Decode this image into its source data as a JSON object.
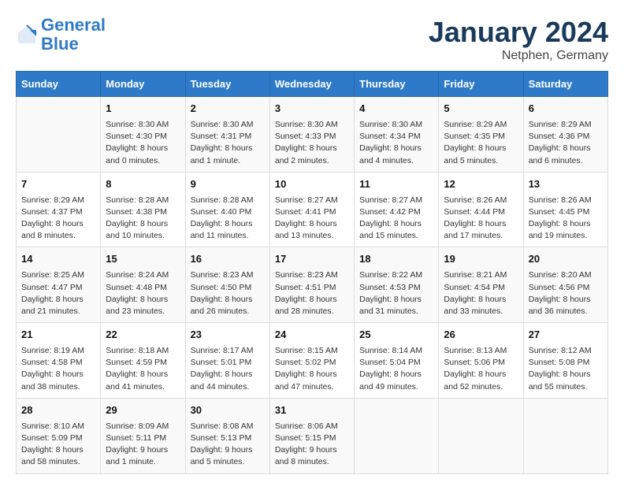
{
  "header": {
    "logo_line1": "General",
    "logo_line2": "Blue",
    "month": "January 2024",
    "location": "Netphen, Germany"
  },
  "days_of_week": [
    "Sunday",
    "Monday",
    "Tuesday",
    "Wednesday",
    "Thursday",
    "Friday",
    "Saturday"
  ],
  "weeks": [
    [
      {
        "num": "",
        "sunrise": "",
        "sunset": "",
        "daylight": ""
      },
      {
        "num": "1",
        "sunrise": "Sunrise: 8:30 AM",
        "sunset": "Sunset: 4:30 PM",
        "daylight": "Daylight: 8 hours and 0 minutes."
      },
      {
        "num": "2",
        "sunrise": "Sunrise: 8:30 AM",
        "sunset": "Sunset: 4:31 PM",
        "daylight": "Daylight: 8 hours and 1 minute."
      },
      {
        "num": "3",
        "sunrise": "Sunrise: 8:30 AM",
        "sunset": "Sunset: 4:33 PM",
        "daylight": "Daylight: 8 hours and 2 minutes."
      },
      {
        "num": "4",
        "sunrise": "Sunrise: 8:30 AM",
        "sunset": "Sunset: 4:34 PM",
        "daylight": "Daylight: 8 hours and 4 minutes."
      },
      {
        "num": "5",
        "sunrise": "Sunrise: 8:29 AM",
        "sunset": "Sunset: 4:35 PM",
        "daylight": "Daylight: 8 hours and 5 minutes."
      },
      {
        "num": "6",
        "sunrise": "Sunrise: 8:29 AM",
        "sunset": "Sunset: 4:36 PM",
        "daylight": "Daylight: 8 hours and 6 minutes."
      }
    ],
    [
      {
        "num": "7",
        "sunrise": "Sunrise: 8:29 AM",
        "sunset": "Sunset: 4:37 PM",
        "daylight": "Daylight: 8 hours and 8 minutes."
      },
      {
        "num": "8",
        "sunrise": "Sunrise: 8:28 AM",
        "sunset": "Sunset: 4:38 PM",
        "daylight": "Daylight: 8 hours and 10 minutes."
      },
      {
        "num": "9",
        "sunrise": "Sunrise: 8:28 AM",
        "sunset": "Sunset: 4:40 PM",
        "daylight": "Daylight: 8 hours and 11 minutes."
      },
      {
        "num": "10",
        "sunrise": "Sunrise: 8:27 AM",
        "sunset": "Sunset: 4:41 PM",
        "daylight": "Daylight: 8 hours and 13 minutes."
      },
      {
        "num": "11",
        "sunrise": "Sunrise: 8:27 AM",
        "sunset": "Sunset: 4:42 PM",
        "daylight": "Daylight: 8 hours and 15 minutes."
      },
      {
        "num": "12",
        "sunrise": "Sunrise: 8:26 AM",
        "sunset": "Sunset: 4:44 PM",
        "daylight": "Daylight: 8 hours and 17 minutes."
      },
      {
        "num": "13",
        "sunrise": "Sunrise: 8:26 AM",
        "sunset": "Sunset: 4:45 PM",
        "daylight": "Daylight: 8 hours and 19 minutes."
      }
    ],
    [
      {
        "num": "14",
        "sunrise": "Sunrise: 8:25 AM",
        "sunset": "Sunset: 4:47 PM",
        "daylight": "Daylight: 8 hours and 21 minutes."
      },
      {
        "num": "15",
        "sunrise": "Sunrise: 8:24 AM",
        "sunset": "Sunset: 4:48 PM",
        "daylight": "Daylight: 8 hours and 23 minutes."
      },
      {
        "num": "16",
        "sunrise": "Sunrise: 8:23 AM",
        "sunset": "Sunset: 4:50 PM",
        "daylight": "Daylight: 8 hours and 26 minutes."
      },
      {
        "num": "17",
        "sunrise": "Sunrise: 8:23 AM",
        "sunset": "Sunset: 4:51 PM",
        "daylight": "Daylight: 8 hours and 28 minutes."
      },
      {
        "num": "18",
        "sunrise": "Sunrise: 8:22 AM",
        "sunset": "Sunset: 4:53 PM",
        "daylight": "Daylight: 8 hours and 31 minutes."
      },
      {
        "num": "19",
        "sunrise": "Sunrise: 8:21 AM",
        "sunset": "Sunset: 4:54 PM",
        "daylight": "Daylight: 8 hours and 33 minutes."
      },
      {
        "num": "20",
        "sunrise": "Sunrise: 8:20 AM",
        "sunset": "Sunset: 4:56 PM",
        "daylight": "Daylight: 8 hours and 36 minutes."
      }
    ],
    [
      {
        "num": "21",
        "sunrise": "Sunrise: 8:19 AM",
        "sunset": "Sunset: 4:58 PM",
        "daylight": "Daylight: 8 hours and 38 minutes."
      },
      {
        "num": "22",
        "sunrise": "Sunrise: 8:18 AM",
        "sunset": "Sunset: 4:59 PM",
        "daylight": "Daylight: 8 hours and 41 minutes."
      },
      {
        "num": "23",
        "sunrise": "Sunrise: 8:17 AM",
        "sunset": "Sunset: 5:01 PM",
        "daylight": "Daylight: 8 hours and 44 minutes."
      },
      {
        "num": "24",
        "sunrise": "Sunrise: 8:15 AM",
        "sunset": "Sunset: 5:02 PM",
        "daylight": "Daylight: 8 hours and 47 minutes."
      },
      {
        "num": "25",
        "sunrise": "Sunrise: 8:14 AM",
        "sunset": "Sunset: 5:04 PM",
        "daylight": "Daylight: 8 hours and 49 minutes."
      },
      {
        "num": "26",
        "sunrise": "Sunrise: 8:13 AM",
        "sunset": "Sunset: 5:06 PM",
        "daylight": "Daylight: 8 hours and 52 minutes."
      },
      {
        "num": "27",
        "sunrise": "Sunrise: 8:12 AM",
        "sunset": "Sunset: 5:08 PM",
        "daylight": "Daylight: 8 hours and 55 minutes."
      }
    ],
    [
      {
        "num": "28",
        "sunrise": "Sunrise: 8:10 AM",
        "sunset": "Sunset: 5:09 PM",
        "daylight": "Daylight: 8 hours and 58 minutes."
      },
      {
        "num": "29",
        "sunrise": "Sunrise: 8:09 AM",
        "sunset": "Sunset: 5:11 PM",
        "daylight": "Daylight: 9 hours and 1 minute."
      },
      {
        "num": "30",
        "sunrise": "Sunrise: 8:08 AM",
        "sunset": "Sunset: 5:13 PM",
        "daylight": "Daylight: 9 hours and 5 minutes."
      },
      {
        "num": "31",
        "sunrise": "Sunrise: 8:06 AM",
        "sunset": "Sunset: 5:15 PM",
        "daylight": "Daylight: 9 hours and 8 minutes."
      },
      {
        "num": "",
        "sunrise": "",
        "sunset": "",
        "daylight": ""
      },
      {
        "num": "",
        "sunrise": "",
        "sunset": "",
        "daylight": ""
      },
      {
        "num": "",
        "sunrise": "",
        "sunset": "",
        "daylight": ""
      }
    ]
  ]
}
